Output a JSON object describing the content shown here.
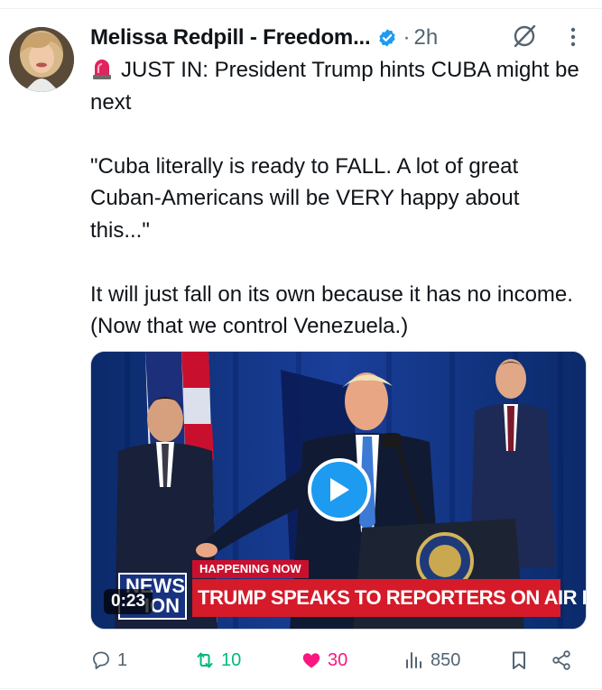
{
  "post": {
    "author": {
      "display_name": "Melissa Redpill - Freedom...",
      "verified": true
    },
    "separator": "·",
    "timestamp": "2h",
    "text_line1": "JUST IN: President Trump hints CUBA might be next",
    "text_body": "\n\n\"Cuba literally is ready to FALL. A lot of great Cuban-Americans will be VERY happy about this...\"\n\nIt will just fall on its own because it has no income. (Now that we control Venezuela.)",
    "media": {
      "type": "video",
      "duration": "0:23",
      "overlay": {
        "network_logo": "NEWS NATION",
        "network_logo_line1": "NEWS",
        "network_logo_line2": "ION",
        "tag": "HAPPENING NOW",
        "headline": "TRUMP SPEAKS TO REPORTERS ON AIR FORCE ONE"
      }
    },
    "actions": {
      "replies": "1",
      "reposts": "10",
      "likes": "30",
      "views": "850",
      "liked": true,
      "reposted": true
    }
  },
  "icons": [
    "avatar",
    "verified-badge-icon",
    "grok-icon",
    "more-icon",
    "siren-icon",
    "play-icon",
    "reply-icon",
    "repost-icon",
    "like-icon",
    "views-icon",
    "bookmark-icon",
    "share-icon"
  ],
  "colors": {
    "accent": "#1d9bf0",
    "repost": "#00ba7c",
    "like": "#f91880",
    "muted": "#536471",
    "text": "#0f1419"
  }
}
